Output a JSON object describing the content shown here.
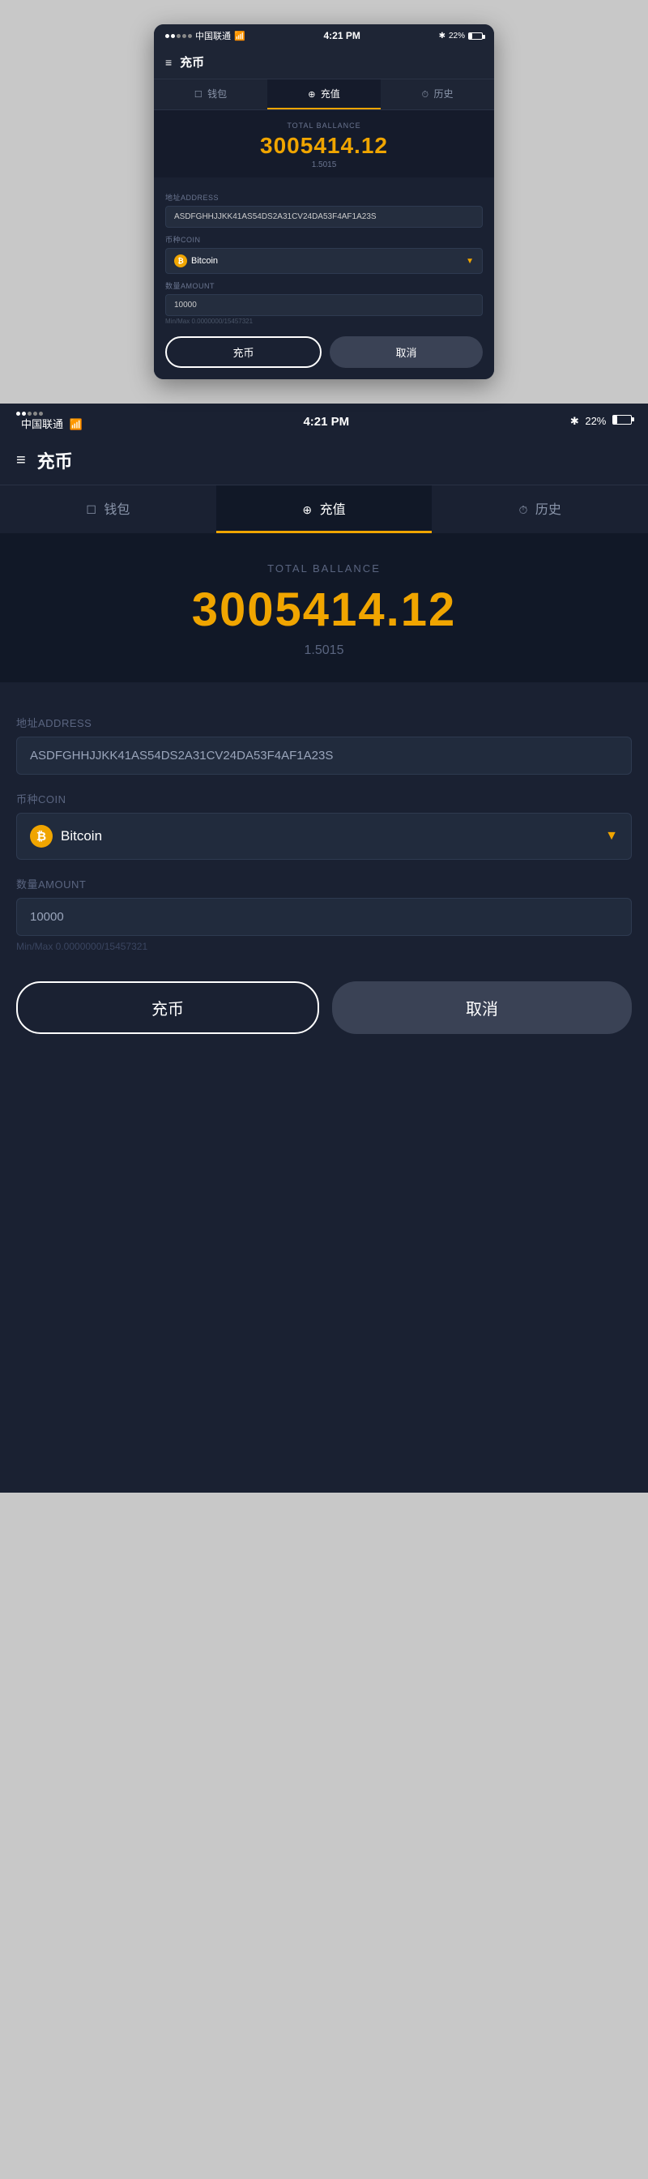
{
  "app": {
    "title": "充币",
    "status_bar": {
      "carrier": "中国联通",
      "signal": "WiFi",
      "time": "4:21 PM",
      "bluetooth": "22%"
    },
    "tabs": [
      {
        "id": "wallet",
        "icon": "☰",
        "label": "钱包",
        "icon_type": "wallet"
      },
      {
        "id": "recharge",
        "icon": "⊕",
        "label": "充值",
        "active": true
      },
      {
        "id": "history",
        "icon": "⏱",
        "label": "历史"
      }
    ],
    "balance": {
      "label": "TOTAL BALLANCE",
      "amount": "3005414.12",
      "sub": "1.5015"
    },
    "form": {
      "address_label": "地址ADDRESS",
      "address_value": "ASDFGHHJJKK41AS54DS2A31CV24DA53F4AF1A23S",
      "coin_label": "币种COIN",
      "coin_value": "Bitcoin",
      "amount_label": "数量AMOUNT",
      "amount_value": "10000",
      "amount_hint": "Min/Max  0.0000000/15457321"
    },
    "buttons": {
      "charge": "充币",
      "cancel": "取消"
    }
  }
}
